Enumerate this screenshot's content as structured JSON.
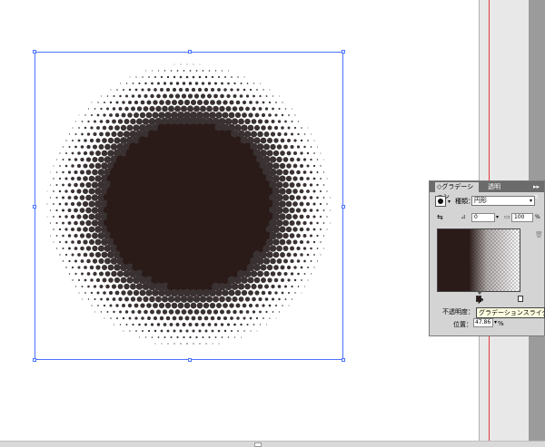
{
  "panel": {
    "tabs": [
      "◇グラデーション",
      "透明"
    ],
    "menu_icon": "▸▸ ≡",
    "type_label": "種類：",
    "type_value": "円形",
    "angle_value": "0",
    "aspect_value": "100",
    "aspect_unit": "%",
    "opacity_label": "不透明度：",
    "location_label": "位置：",
    "location_value": "47.86",
    "location_unit": "%",
    "tooltip": "グラデーションスライダ"
  },
  "colors": {
    "selection": "#4a74ff",
    "guide": "#e53b3b",
    "dot": "#2a1a18"
  },
  "icons": [
    "gradient-fill-icon",
    "reverse-gradient-icon",
    "angle-icon",
    "aspect-ratio-icon",
    "trash-icon",
    "cursor-arrow-icon"
  ]
}
